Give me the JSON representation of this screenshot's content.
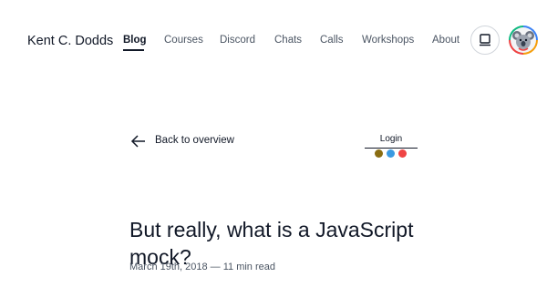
{
  "header": {
    "brand": "Kent C. Dodds",
    "nav": [
      {
        "label": "Blog",
        "active": true
      },
      {
        "label": "Courses",
        "active": false
      },
      {
        "label": "Discord",
        "active": false
      },
      {
        "label": "Chats",
        "active": false
      },
      {
        "label": "Calls",
        "active": false
      },
      {
        "label": "Workshops",
        "active": false
      },
      {
        "label": "About",
        "active": false
      }
    ],
    "theme_button_icon": "laptop-icon",
    "avatar_icon": "koala-avatar"
  },
  "article": {
    "back_label": "Back to overview",
    "login_label": "Login",
    "login_dot_colors": [
      "#8a6d12",
      "#3b9ae1",
      "#ef4444"
    ],
    "title": "But really, what is a JavaScript mock?",
    "meta": "March 19th, 2018 — 11 min read"
  }
}
